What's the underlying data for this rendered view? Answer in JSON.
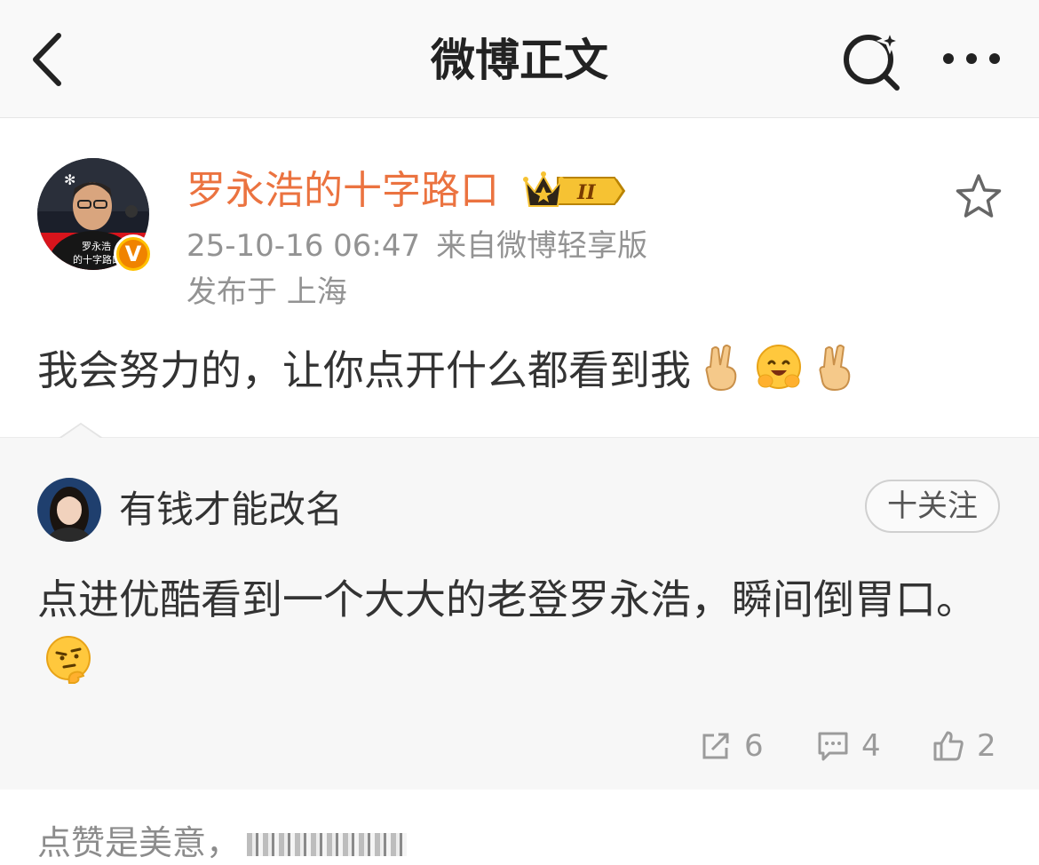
{
  "nav": {
    "title": "微博正文",
    "back_icon": "chevron-left-icon",
    "search_icon": "search-sparkle-icon",
    "more_icon": "more-horizontal-icon"
  },
  "post": {
    "author": "罗永浩的十字路口",
    "avatar_caption_line1": "罗永浩",
    "avatar_caption_line2": "的十字路口",
    "verified_badge": "V",
    "member_badge": "II",
    "time": "25-10-16 06:47",
    "source": "来自微博轻享版",
    "location": "发布于 上海",
    "text": "我会努力的，让你点开什么都看到我",
    "emojis": [
      "victory-hand",
      "hugging-face",
      "victory-hand"
    ]
  },
  "repost": {
    "author": "有钱才能改名",
    "follow_label": "十关注",
    "text": "点进优酷看到一个大大的老登罗永浩，瞬间倒胃口。",
    "emoji": "thinking-face",
    "shares": "6",
    "comments": "4",
    "likes": "2"
  },
  "bottom": {
    "text": "点赞是美意，"
  },
  "colors": {
    "author": "#eb7340",
    "meta": "#939393",
    "repost_bg": "#f7f7f7",
    "accent_badge": "#f08300"
  }
}
